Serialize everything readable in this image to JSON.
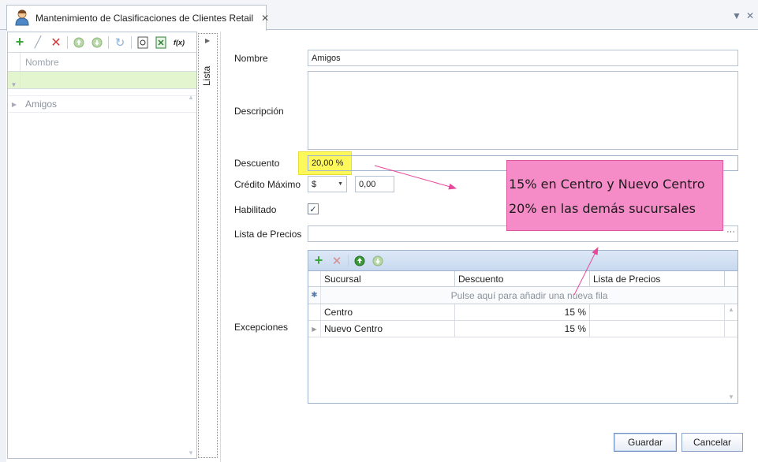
{
  "window": {
    "tab_title": "Mantenimiento de Clasificaciones de Clientes Retail",
    "tab_close": "✕",
    "dropdown_btn": "▼",
    "close_btn": "✕"
  },
  "list_panel": {
    "column_header": "Nombre",
    "rows": [
      "Amigos"
    ],
    "collapsed_label": "Lista",
    "toolbar_fx": "f(x)"
  },
  "form": {
    "nombre_label": "Nombre",
    "nombre_value": "Amigos",
    "descripcion_label": "Descripción",
    "descripcion_value": "",
    "descuento_label": "Descuento",
    "descuento_value": "20,00 %",
    "credito_label": "Crédito Máximo",
    "credito_currency": "$",
    "credito_value": "0,00",
    "habilitado_label": "Habilitado",
    "habilitado_checked": true,
    "habilitado_mark": "✓",
    "lista_precios_label": "Lista de Precios",
    "lista_precios_value": "",
    "lista_precios_button": "···",
    "excepciones_label": "Excepciones"
  },
  "excepciones": {
    "headers": [
      "Sucursal",
      "Descuento",
      "Lista de Precios"
    ],
    "new_row_text": "Pulse aquí para añadir una nueva fila",
    "rows": [
      {
        "sucursal": "Centro",
        "descuento": "15 %",
        "lista": ""
      },
      {
        "sucursal": "Nuevo Centro",
        "descuento": "15 %",
        "lista": ""
      }
    ]
  },
  "annotation": {
    "line1": "15% en Centro y Nuevo Centro",
    "line2": "20% en las demás sucursales"
  },
  "buttons": {
    "guardar": "Guardar",
    "cancelar": "Cancelar"
  },
  "colors": {
    "highlight": "#fff85a",
    "annotation_bg": "#f58cc7",
    "arrow": "#e8489a",
    "filter_row": "#e2f5cf",
    "add_icon": "#3aa53a",
    "delete_icon": "#d03b3b"
  }
}
